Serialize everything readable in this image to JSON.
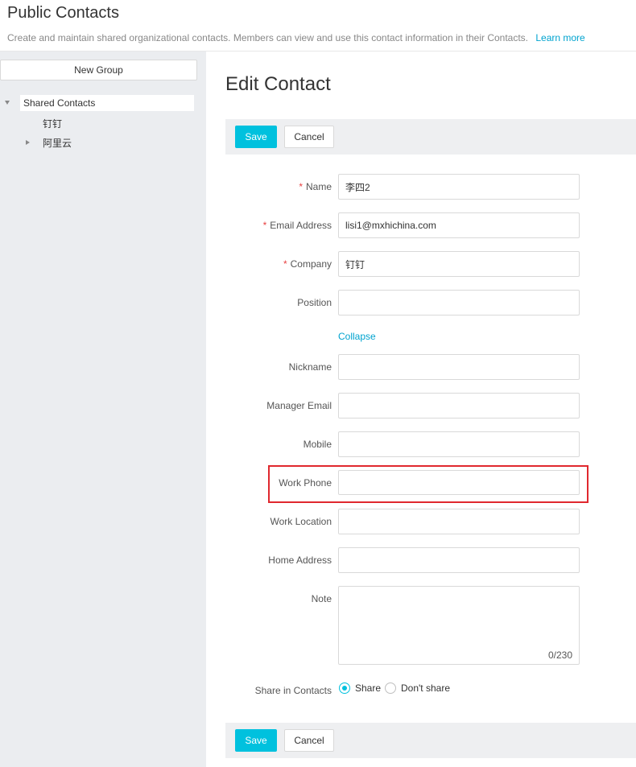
{
  "header": {
    "title": "Public Contacts",
    "description": "Create and maintain shared organizational contacts. Members can view and use this contact information in their Contacts.",
    "learn_more": "Learn more"
  },
  "sidebar": {
    "new_group_label": "New Group",
    "tree": [
      {
        "label": "Shared Contacts",
        "expanded": true,
        "selected": true
      },
      {
        "label": "钉钉"
      },
      {
        "label": "阿里云",
        "expanded": false
      }
    ]
  },
  "form": {
    "title": "Edit Contact",
    "save_label": "Save",
    "cancel_label": "Cancel",
    "collapse_label": "Collapse",
    "fields": {
      "name": {
        "label": "Name",
        "value": "李四2",
        "required": true
      },
      "email": {
        "label": "Email Address",
        "value": "lisi1@mxhichina.com",
        "required": true
      },
      "company": {
        "label": "Company",
        "value": "钉钉",
        "required": true
      },
      "position": {
        "label": "Position",
        "value": ""
      },
      "nickname": {
        "label": "Nickname",
        "value": ""
      },
      "manager_email": {
        "label": "Manager Email",
        "value": ""
      },
      "mobile": {
        "label": "Mobile",
        "value": ""
      },
      "work_phone": {
        "label": "Work Phone",
        "value": ""
      },
      "work_location": {
        "label": "Work Location",
        "value": ""
      },
      "home_address": {
        "label": "Home Address",
        "value": ""
      },
      "note": {
        "label": "Note",
        "value": "",
        "counter": "0/230"
      }
    },
    "share": {
      "label": "Share in Contacts",
      "options": [
        "Share",
        "Don't share"
      ],
      "selected": "Share"
    },
    "required_marker": "*"
  },
  "colors": {
    "accent": "#00c1de",
    "link": "#00a3cf",
    "required": "#e84141",
    "highlight_box": "#e0282e",
    "sidebar_bg": "#ebedf0",
    "toolbar_bg": "#eeeff1"
  }
}
